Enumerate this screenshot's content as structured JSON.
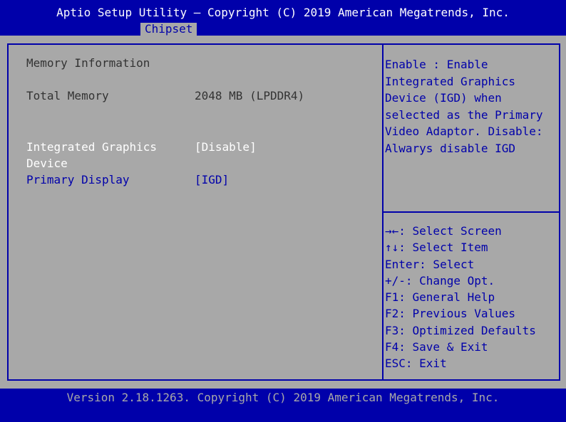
{
  "header": {
    "title": "Aptio Setup Utility – Copyright (C) 2019 American Megatrends, Inc.",
    "active_tab": "Chipset"
  },
  "main": {
    "section_heading": "Memory Information",
    "total_memory": {
      "label": "Total Memory",
      "value": "2048 MB (LPDDR4)"
    },
    "integrated_graphics": {
      "label_line1": "Integrated Graphics",
      "label_line2": "Device",
      "value": "[Disable]"
    },
    "primary_display": {
      "label": "Primary Display",
      "value": "[IGD]"
    }
  },
  "help": {
    "lines": [
      "Enable : Enable",
      "Integrated Graphics",
      "Device (IGD) when",
      "selected as the Primary",
      "Video Adaptor. Disable:",
      "Alwarys disable IGD"
    ]
  },
  "keys": {
    "items": [
      "→←: Select Screen",
      "↑↓: Select Item",
      "Enter: Select",
      "+/-: Change Opt.",
      "F1: General Help",
      "F2: Previous Values",
      "F3: Optimized Defaults",
      "F4: Save & Exit",
      "ESC: Exit"
    ]
  },
  "footer": {
    "text": "Version 2.18.1263. Copyright (C) 2019 American Megatrends, Inc."
  },
  "colors": {
    "background_blue": "#0000aa",
    "panel_gray": "#a8a8a8",
    "highlight_white": "#ffffff"
  }
}
